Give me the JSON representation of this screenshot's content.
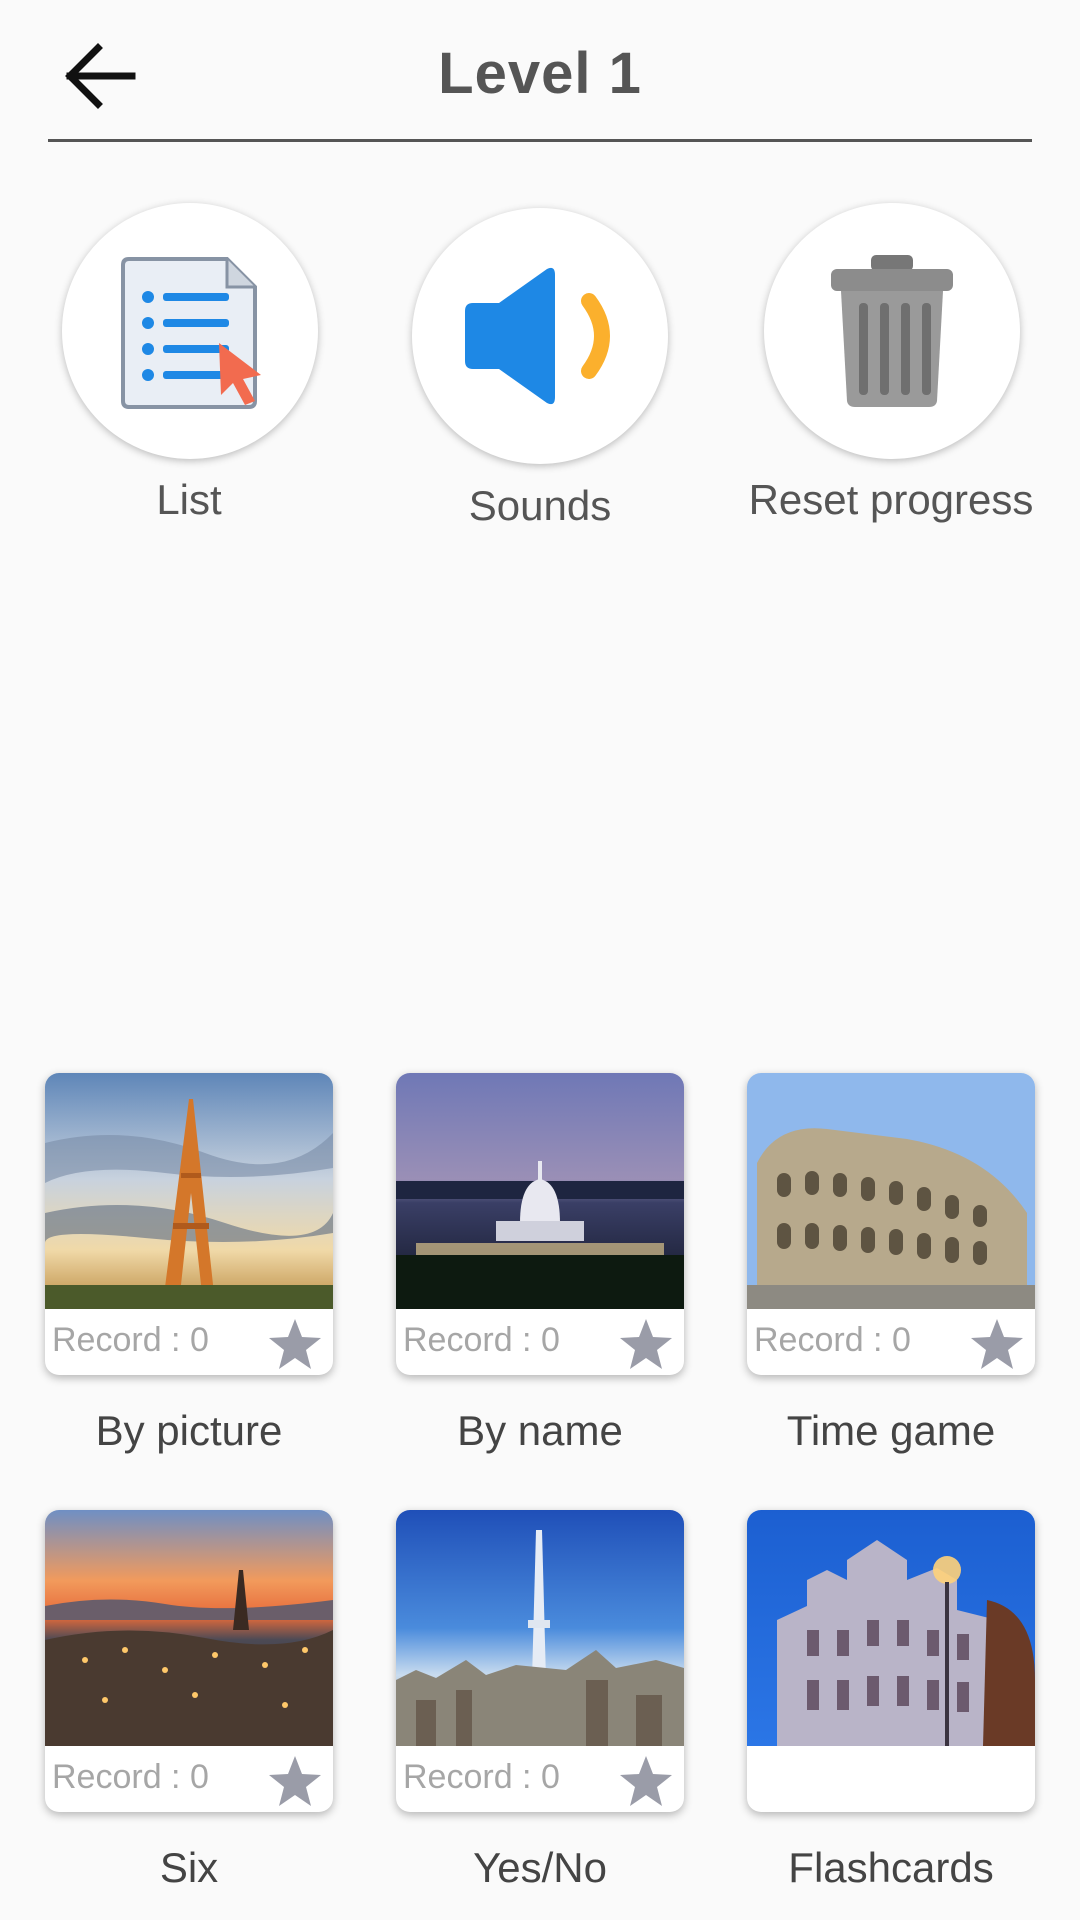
{
  "header": {
    "title": "Level 1",
    "back_icon": "arrow-left-icon"
  },
  "actions": [
    {
      "label": "List",
      "icon": "list-document-icon"
    },
    {
      "label": "Sounds",
      "icon": "speaker-icon"
    },
    {
      "label": "Reset progress",
      "icon": "trash-can-icon"
    }
  ],
  "modes": [
    {
      "label": "By picture",
      "record": "Record : 0",
      "star_icon": "star-icon",
      "image": "eiffel-tower-photo"
    },
    {
      "label": "By name",
      "record": "Record : 0",
      "star_icon": "star-icon",
      "image": "us-capitol-photo"
    },
    {
      "label": "Time game",
      "record": "Record : 0",
      "star_icon": "star-icon",
      "image": "colosseum-photo"
    },
    {
      "label": "Six",
      "record": "Record : 0",
      "star_icon": "star-icon",
      "image": "bern-city-photo"
    },
    {
      "label": "Yes/No",
      "record": "Record : 0",
      "star_icon": "star-icon",
      "image": "tokyo-skytree-photo"
    },
    {
      "label": "Flashcards",
      "image": "madrid-palace-photo"
    }
  ],
  "colors": {
    "speaker_blue": "#1e88e5",
    "sound_wave": "#fbb02d",
    "list_arrow": "#f26b4f",
    "star_gray": "#9a9ca8"
  }
}
